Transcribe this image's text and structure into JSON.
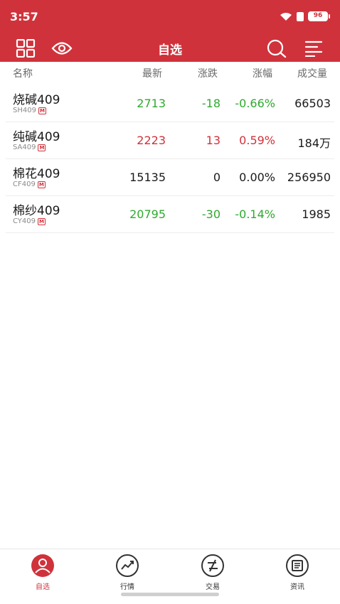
{
  "status_bar": {
    "time": "3:57",
    "battery": "96"
  },
  "nav": {
    "title": "自选"
  },
  "columns": {
    "name": "名称",
    "last": "最新",
    "change": "涨跌",
    "pct": "涨幅",
    "volume": "成交量"
  },
  "colors": {
    "up": "#d0323b",
    "down": "#2eaa2e",
    "flat": "#1a1a1a",
    "brand": "#d0323b"
  },
  "rows": [
    {
      "name": "烧碱409",
      "code": "SH409",
      "badge": "M",
      "last": "2713",
      "change": "-18",
      "pct": "-0.66%",
      "volume": "66503",
      "trend": "down"
    },
    {
      "name": "纯碱409",
      "code": "SA409",
      "badge": "M",
      "last": "2223",
      "change": "13",
      "pct": "0.59%",
      "volume": "184万",
      "trend": "up"
    },
    {
      "name": "棉花409",
      "code": "CF409",
      "badge": "M",
      "last": "15135",
      "change": "0",
      "pct": "0.00%",
      "volume": "256950",
      "trend": "flat"
    },
    {
      "name": "棉纱409",
      "code": "CY409",
      "badge": "M",
      "last": "20795",
      "change": "-30",
      "pct": "-0.14%",
      "volume": "1985",
      "trend": "down"
    }
  ],
  "tabs": [
    {
      "label": "自选",
      "icon": "user-icon",
      "active": true
    },
    {
      "label": "行情",
      "icon": "trend-icon",
      "active": false
    },
    {
      "label": "交易",
      "icon": "trade-icon",
      "active": false
    },
    {
      "label": "资讯",
      "icon": "news-icon",
      "active": false
    }
  ]
}
